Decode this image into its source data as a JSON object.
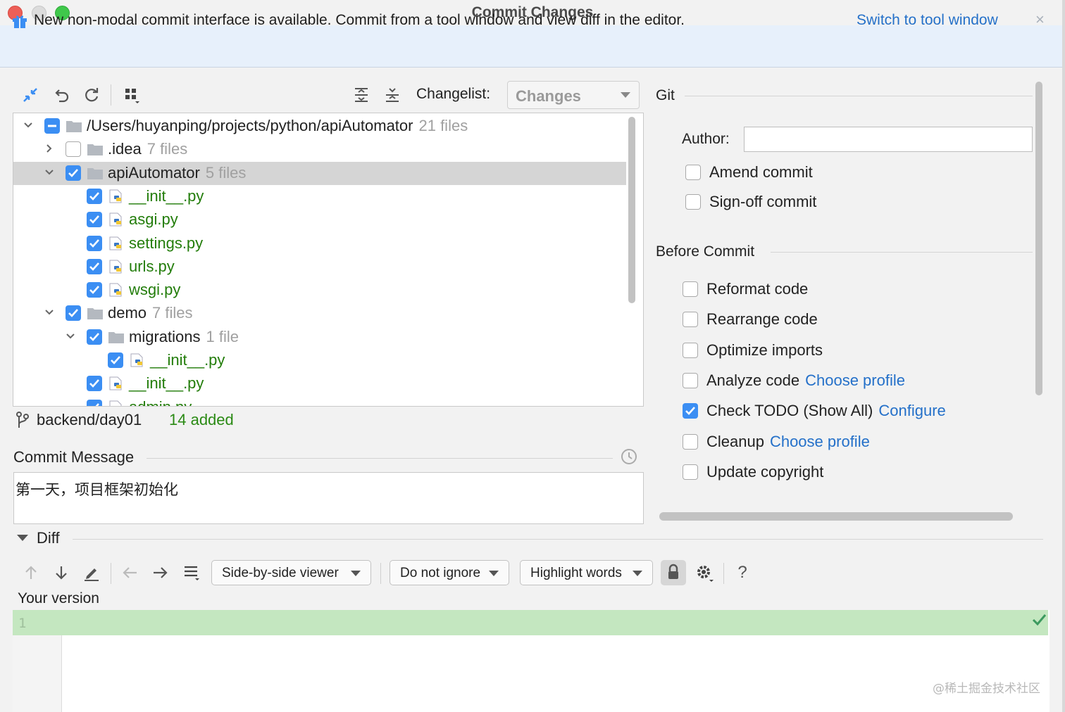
{
  "window": {
    "title": "Commit Changes"
  },
  "banner": {
    "text": "New non-modal commit interface is available. Commit from a tool window and view diff in the editor.",
    "link": "Switch to tool window",
    "close": "×"
  },
  "toolbar": {
    "changelist_label": "Changelist:",
    "changelist_value": "Changes"
  },
  "tree": [
    {
      "name": "/Users/huyanping/projects/python/apiAutomator",
      "count": "21 files",
      "type": "folder",
      "expanded": true,
      "check": "mixed"
    },
    {
      "name": ".idea",
      "count": "7 files",
      "type": "folder",
      "expanded": false,
      "check": "off"
    },
    {
      "name": "apiAutomator",
      "count": "5 files",
      "type": "folder",
      "expanded": true,
      "check": "on",
      "selected": true
    },
    {
      "name": "__init__.py",
      "count": "",
      "type": "file",
      "check": "on"
    },
    {
      "name": "asgi.py",
      "count": "",
      "type": "file",
      "check": "on"
    },
    {
      "name": "settings.py",
      "count": "",
      "type": "file",
      "check": "on"
    },
    {
      "name": "urls.py",
      "count": "",
      "type": "file",
      "check": "on"
    },
    {
      "name": "wsgi.py",
      "count": "",
      "type": "file",
      "check": "on"
    },
    {
      "name": "demo",
      "count": "7 files",
      "type": "folder",
      "expanded": true,
      "check": "on"
    },
    {
      "name": "migrations",
      "count": "1 file",
      "type": "folder",
      "expanded": true,
      "check": "on"
    },
    {
      "name": "__init__.py",
      "count": "",
      "type": "file",
      "check": "on"
    },
    {
      "name": "__init__.py",
      "count": "",
      "type": "file",
      "check": "on"
    },
    {
      "name": "admin.py",
      "count": "",
      "type": "file",
      "check": "on"
    }
  ],
  "status": {
    "branch": "backend/day01",
    "added": "14 added"
  },
  "commit_message": {
    "label": "Commit Message",
    "text": "第一天，项目框架初始化"
  },
  "git": {
    "title": "Git",
    "author_label": "Author:",
    "author_value": "",
    "options": [
      {
        "label": "Amend commit",
        "checked": false
      },
      {
        "label": "Sign-off commit",
        "checked": false
      }
    ]
  },
  "before_commit": {
    "title": "Before Commit",
    "options": [
      {
        "label": "Reformat code",
        "link": "",
        "checked": false
      },
      {
        "label": "Rearrange code",
        "link": "",
        "checked": false
      },
      {
        "label": "Optimize imports",
        "link": "",
        "checked": false
      },
      {
        "label": "Analyze code",
        "link": "Choose profile",
        "checked": false
      },
      {
        "label": "Check TODO (Show All)",
        "link": "Configure",
        "checked": true
      },
      {
        "label": "Cleanup",
        "link": "Choose profile",
        "checked": false
      },
      {
        "label": "Update copyright",
        "link": "",
        "checked": false
      }
    ]
  },
  "diff": {
    "label": "Diff",
    "viewer": "Side-by-side viewer",
    "ignore": "Do not ignore",
    "highlight": "Highlight words",
    "help": "?",
    "your_version": "Your version",
    "line_number": "1"
  },
  "watermark": "@稀土掘金技术社区",
  "colors": {
    "accent": "#3b8ef3",
    "link": "#2470c9",
    "added": "#237d0b",
    "diff_added_bg": "#c4e7c0"
  }
}
